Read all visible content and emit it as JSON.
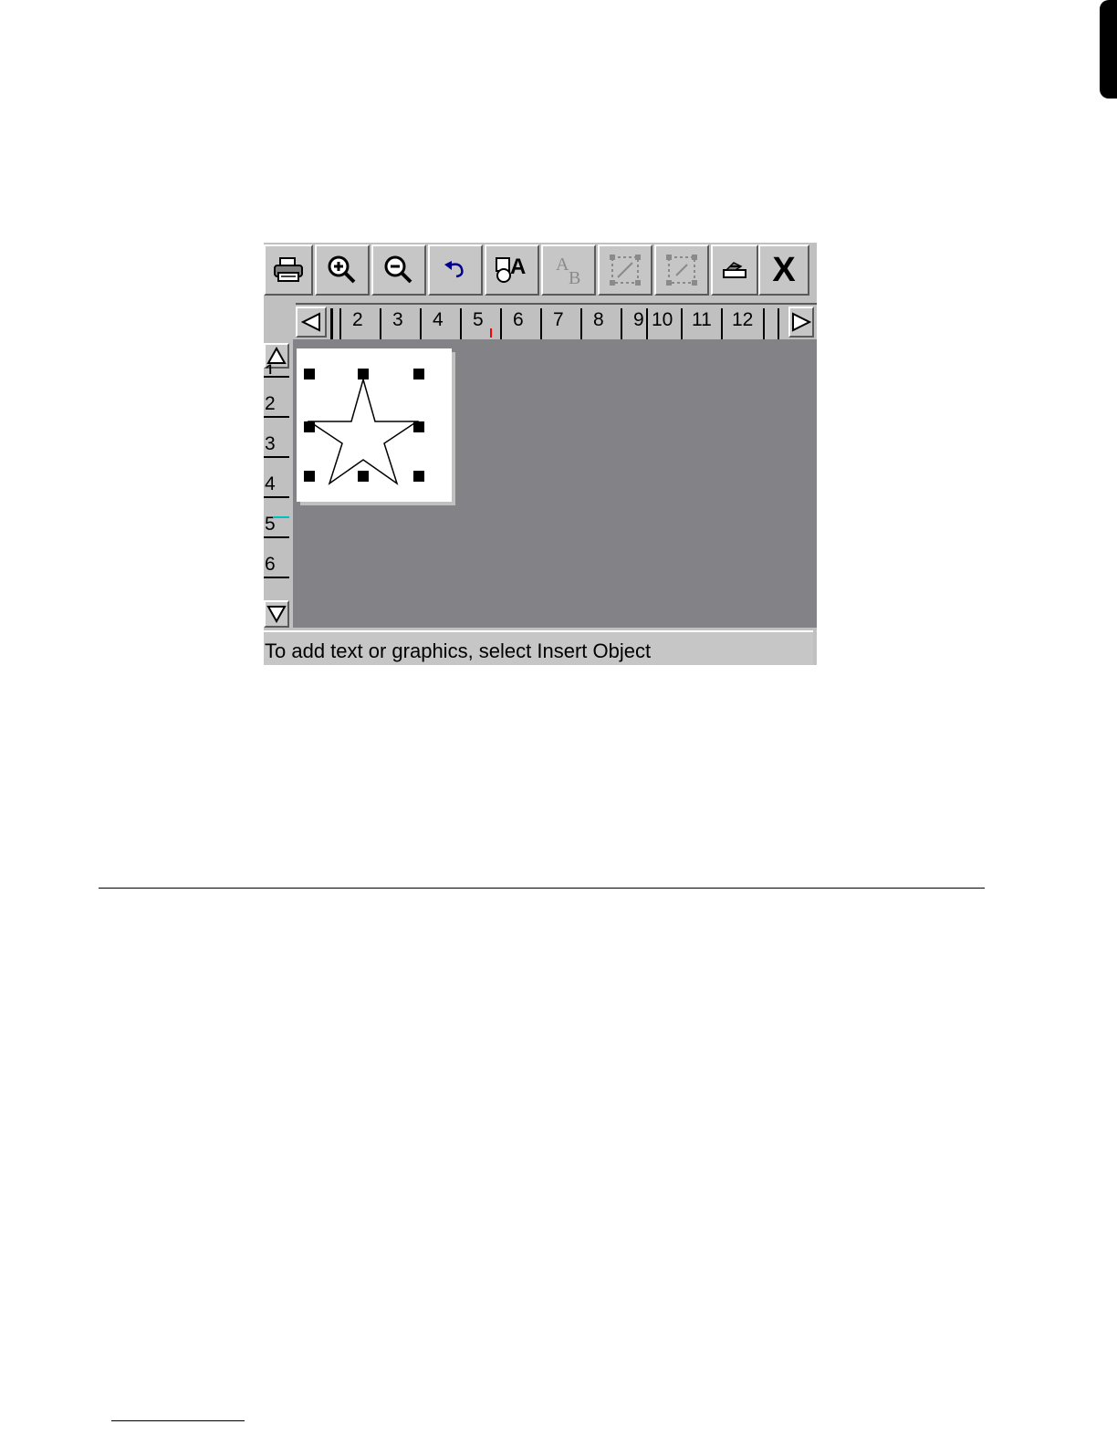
{
  "toolbar": {
    "buttons": [
      {
        "name": "print",
        "icon": "printer-icon"
      },
      {
        "name": "zoom-in",
        "icon": "zoom-in-icon"
      },
      {
        "name": "zoom-out",
        "icon": "zoom-out-icon"
      },
      {
        "name": "undo",
        "icon": "undo-icon"
      },
      {
        "name": "insert-object",
        "icon": "insert-object-icon",
        "glyph": "A"
      },
      {
        "name": "text-format",
        "icon": "text-format-icon",
        "glyph_a": "A",
        "glyph_b": "B",
        "disabled": true
      },
      {
        "name": "select-frame",
        "icon": "select-frame-icon",
        "disabled": true
      },
      {
        "name": "select-partial",
        "icon": "select-partial-icon",
        "disabled": true
      },
      {
        "name": "settings",
        "icon": "tool-icon"
      },
      {
        "name": "close",
        "icon": "close-icon",
        "glyph": "X"
      }
    ]
  },
  "ruler_top": {
    "numbers": [
      "2",
      "3",
      "4",
      "5",
      "6",
      "7",
      "8",
      "9",
      "10",
      "11",
      "12"
    ]
  },
  "ruler_left": {
    "numbers": [
      "1",
      "2",
      "3",
      "4",
      "5",
      "6"
    ]
  },
  "status": {
    "text": "To add text or graphics, select Insert Object"
  },
  "colors": {
    "toolbar_bg": "#c0c0c0",
    "canvas_bg": "#838286",
    "label_bg": "#ffffff",
    "ruler_cursor": "#ff0000",
    "ruler_left_marker": "#00c0c0"
  }
}
